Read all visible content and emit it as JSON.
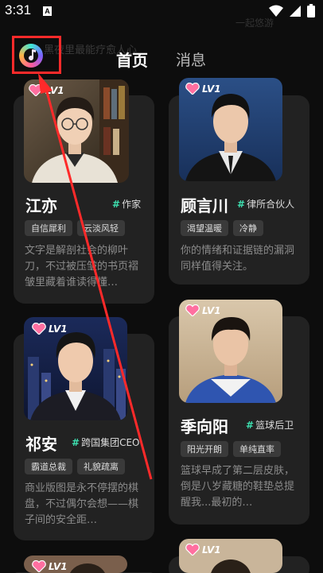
{
  "status_bar": {
    "time": "3:31",
    "notification_letter": "A"
  },
  "background_text": {
    "left": "黑夜里最能疗愈人心",
    "right": "一起悠游"
  },
  "header": {
    "tabs": {
      "home": "首页",
      "messages": "消息"
    }
  },
  "characters": [
    {
      "level": "LV1",
      "name": "江亦",
      "role": "作家",
      "tags": [
        "自信犀利",
        "云淡风轻"
      ],
      "description": "文字是解剖社会的柳叶刀，不过被压皱的书页褶皱里藏着谁读得懂…"
    },
    {
      "level": "LV1",
      "name": "顾言川",
      "role": "律所合伙人",
      "tags": [
        "渴望温暖",
        "冷静"
      ],
      "description": "你的情绪和证据链的漏洞同样值得关注。"
    },
    {
      "level": "LV1",
      "name": "祁安",
      "role": "跨国集团CEO",
      "tags": [
        "霸道总裁",
        "礼貌疏离"
      ],
      "description": "商业版图是永不停摆的棋盘，不过偶尔会想——棋子间的安全距…"
    },
    {
      "level": "LV1",
      "name": "季向阳",
      "role": "篮球后卫",
      "tags": [
        "阳光开朗",
        "单纯直率"
      ],
      "description": "篮球早成了第二层皮肤，倒是八岁藏糖的鞋垫总提醒我...最初的…"
    },
    {
      "level": "LV1"
    },
    {
      "level": "LV1"
    }
  ],
  "colors": {
    "accent": "#3ee0b0",
    "annotation": "#ff2a2a",
    "card_bg": "#222222"
  }
}
